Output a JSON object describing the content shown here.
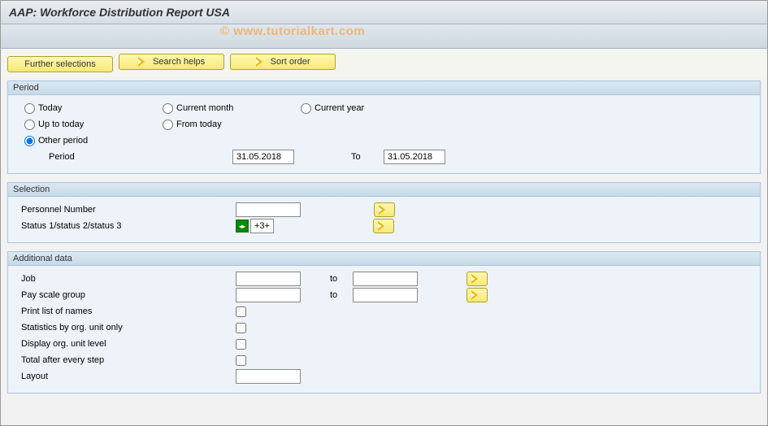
{
  "header": {
    "title": "AAP: Workforce Distribution Report USA"
  },
  "watermark": "© www.tutorialkart.com",
  "toolbar": {
    "further_selections": "Further selections",
    "search_helps": "Search helps",
    "sort_order": "Sort order"
  },
  "period": {
    "group_title": "Period",
    "radios": {
      "today": "Today",
      "current_month": "Current month",
      "current_year": "Current year",
      "up_to_today": "Up to today",
      "from_today": "From today",
      "other_period": "Other period"
    },
    "period_label": "Period",
    "from_value": "31.05.2018",
    "to_label": "To",
    "to_value": "31.05.2018"
  },
  "selection": {
    "group_title": "Selection",
    "personnel_number": "Personnel Number",
    "status_label": "Status 1/status 2/status 3",
    "status_badge": "+3+"
  },
  "additional": {
    "group_title": "Additional data",
    "job": "Job",
    "to": "to",
    "pay_scale_group": "Pay scale group",
    "print_list": "Print list of names",
    "stats_org": "Statistics by org. unit only",
    "display_org": "Display org. unit level",
    "total_after": "Total after every step",
    "layout": "Layout"
  }
}
